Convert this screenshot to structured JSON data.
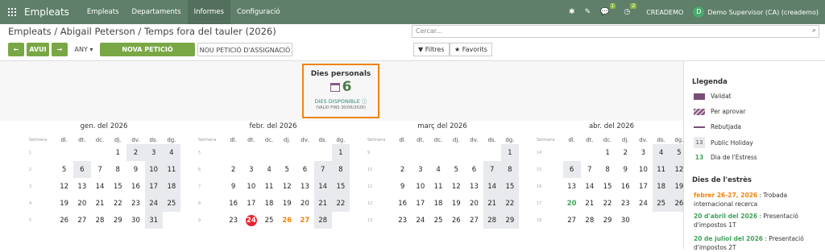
{
  "nav": {
    "app": "Empleats",
    "menu": [
      "Empleats",
      "Departaments",
      "Informes",
      "Configuració"
    ],
    "company": "CREADEMO",
    "user": "Demo Supervisor (CA) (creademo)",
    "avatar": "D",
    "badge_chat": "1",
    "badge_activity": "2"
  },
  "breadcrumb": "Empleats / Abigail Peterson / Temps fora del tauler (2026)",
  "search": {
    "placeholder": "Cercar..."
  },
  "toolbar": {
    "prev": "←",
    "today": "AVUI",
    "next": "→",
    "year": "ANY",
    "new_absence": "NOVA PETICIÓ D'ABSÈNCIA",
    "new_allocation": "NOU PETICIÓ D'ASSIGNACIÓ",
    "filters": "Filtres",
    "favorites": "Favorits"
  },
  "card": {
    "title": "Dies personals",
    "number": "6",
    "available": "DIES DISPONIBLE",
    "valid": "(VALID FINS 30/06/2026)"
  },
  "weekdays": [
    "dl.",
    "dt.",
    "dc.",
    "dj.",
    "dv.",
    "ds.",
    "dg."
  ],
  "week_label": "Setmana",
  "months": [
    {
      "name": "gen. del 2026",
      "rows": [
        [
          "1",
          "",
          "",
          "",
          "1",
          "2",
          "3",
          "4"
        ],
        [
          "2",
          "5",
          "6",
          "7",
          "8",
          "9",
          "10",
          "11"
        ],
        [
          "3",
          "12",
          "13",
          "14",
          "15",
          "16",
          "17",
          "18"
        ],
        [
          "4",
          "19",
          "20",
          "21",
          "22",
          "23",
          "24",
          "25"
        ],
        [
          "5",
          "26",
          "27",
          "28",
          "29",
          "30",
          "31",
          ""
        ]
      ]
    },
    {
      "name": "febr. del 2026",
      "rows": [
        [
          "5",
          "",
          "",
          "",
          "",
          "",
          "",
          "1"
        ],
        [
          "6",
          "2",
          "3",
          "4",
          "5",
          "6",
          "7",
          "8"
        ],
        [
          "7",
          "9",
          "10",
          "11",
          "12",
          "13",
          "14",
          "15"
        ],
        [
          "8",
          "16",
          "17",
          "18",
          "19",
          "20",
          "21",
          "22"
        ],
        [
          "9",
          "23",
          "24",
          "25",
          "26",
          "27",
          "28",
          ""
        ]
      ]
    },
    {
      "name": "març del 2026",
      "rows": [
        [
          "9",
          "",
          "",
          "",
          "",
          "",
          "",
          "1"
        ],
        [
          "10",
          "2",
          "3",
          "4",
          "5",
          "6",
          "7",
          "8"
        ],
        [
          "11",
          "9",
          "10",
          "11",
          "12",
          "13",
          "14",
          "15"
        ],
        [
          "12",
          "16",
          "17",
          "18",
          "19",
          "20",
          "21",
          "22"
        ],
        [
          "13",
          "23",
          "24",
          "25",
          "26",
          "27",
          "28",
          "29"
        ]
      ]
    },
    {
      "name": "abr. del 2026",
      "rows": [
        [
          "14",
          "",
          "",
          "1",
          "2",
          "3",
          "4",
          "5"
        ],
        [
          "15",
          "6",
          "7",
          "8",
          "9",
          "10",
          "11",
          "12"
        ],
        [
          "16",
          "13",
          "14",
          "15",
          "16",
          "17",
          "18",
          "19"
        ],
        [
          "17",
          "20",
          "21",
          "22",
          "23",
          "24",
          "25",
          "26"
        ],
        [
          "18",
          "27",
          "28",
          "29",
          "30",
          "",
          "",
          ""
        ]
      ]
    }
  ],
  "legend": {
    "title": "Llegenda",
    "items": [
      "Validat",
      "Per aprovar",
      "Rebutjada",
      "Public Holiday",
      "Dia de l'Estress"
    ],
    "ph_num": "13",
    "stress_num": "13"
  },
  "stress_days": {
    "title": "Dies de l'estrès",
    "items": [
      {
        "date": "febrer 26-27, 2026",
        "text": " : Trobada internacional recerca"
      },
      {
        "date": "20 d'abril del 2026",
        "text": " : Presentació d'impostos 1T"
      },
      {
        "date": "20 de juliol del 2026",
        "text": " : Presentació d'impostos 2T"
      }
    ]
  },
  "colors": {
    "nav": "#5f7f6a",
    "green_btn": "#7aa745",
    "accent_orange": "#f0830d",
    "validated": "#7a4d76",
    "stress_green": "#3fa35a"
  }
}
